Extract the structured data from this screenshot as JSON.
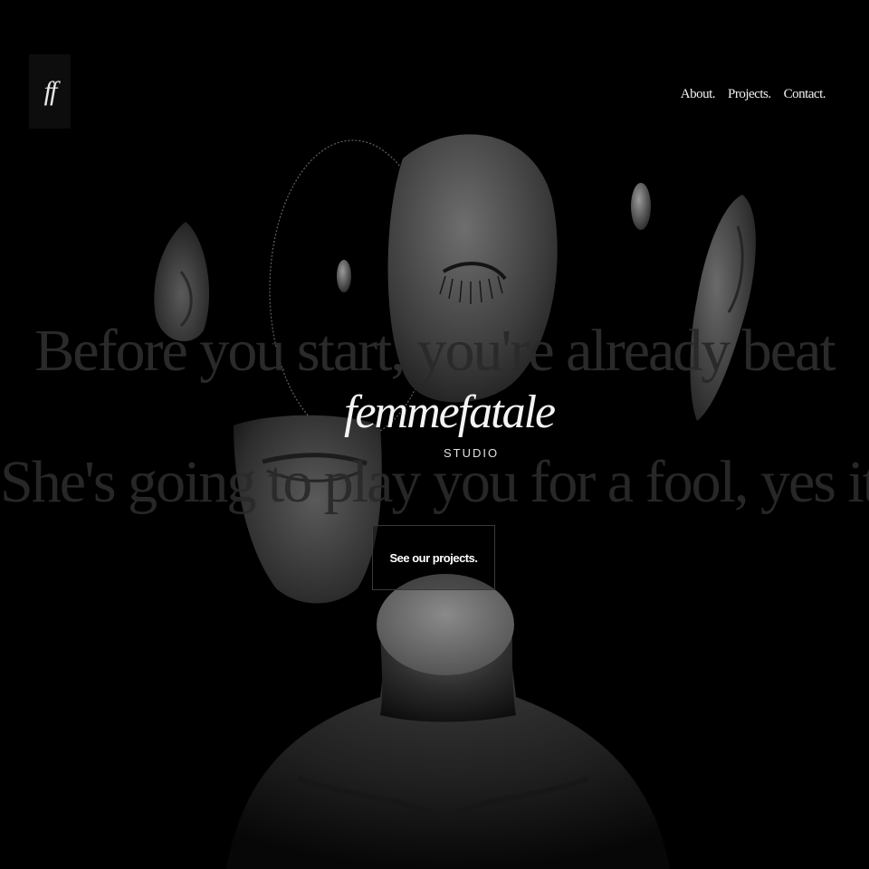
{
  "header": {
    "logo_text": "ff",
    "nav": [
      {
        "label": "About."
      },
      {
        "label": "Projects."
      },
      {
        "label": "Contact."
      }
    ]
  },
  "hero": {
    "background_line_1": "Before you start, you're already beat",
    "background_line_2": "She's going to play you for a fool, yes it's true",
    "brand_name": "femmefatale",
    "brand_subtitle": "STUDIO",
    "cta_label": "See our projects."
  },
  "colors": {
    "background": "#000000",
    "text": "#f2f2f2",
    "faded_text": "#2a2a2a"
  }
}
